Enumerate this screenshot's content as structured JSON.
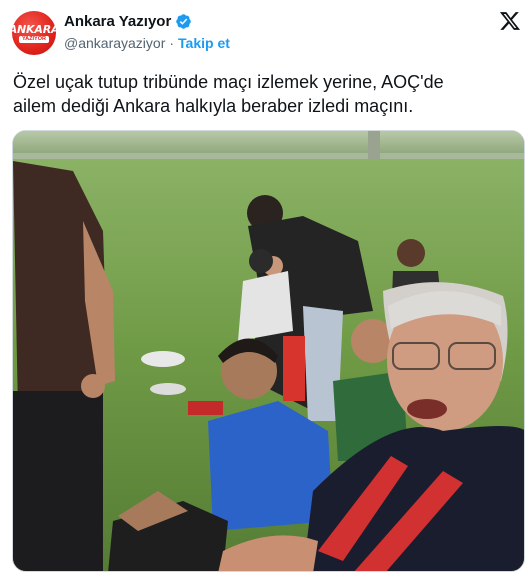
{
  "author": {
    "name": "Ankara Yazıyor",
    "handle": "@ankarayaziyor",
    "separator": "·",
    "follow_label": "Takip et",
    "verified_icon": "verified-badge-icon",
    "avatar_logo": {
      "line1": "ANKARA",
      "line2": "YAZIYOR"
    }
  },
  "platform_icon": "x-logo-icon",
  "tweet": {
    "text": "Özel uçak tutup tribünde maçı izlemek yerine, AOÇ'de\nailem dediği Ankara halkıyla beraber izledi maçını."
  },
  "media": {
    "type": "video-still"
  },
  "colors": {
    "accent": "#1d9bf0",
    "text": "#0f1419",
    "secondary": "#536471",
    "brand_red": "#e0241c"
  }
}
